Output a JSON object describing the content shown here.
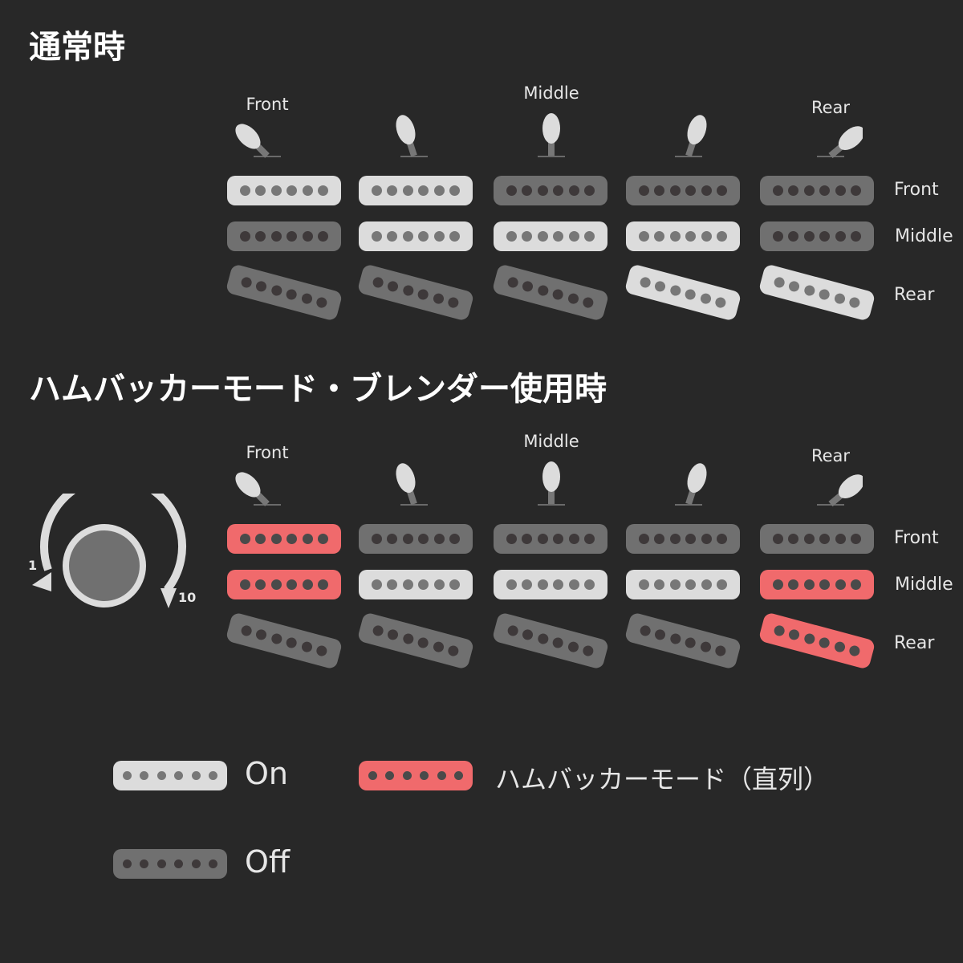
{
  "sections": [
    {
      "title": "通常時",
      "position_labels": [
        "Front",
        "Middle",
        "Rear"
      ],
      "row_labels": [
        "Front",
        "Middle",
        "Rear"
      ],
      "switch_positions": [
        {
          "position": 1,
          "label": "Front"
        },
        {
          "position": 2,
          "label": ""
        },
        {
          "position": 3,
          "label": "Middle"
        },
        {
          "position": 4,
          "label": ""
        },
        {
          "position": 5,
          "label": "Rear"
        }
      ],
      "pickup_states": [
        [
          "on",
          "on",
          "off",
          "off",
          "off"
        ],
        [
          "off",
          "on",
          "on",
          "on",
          "off"
        ],
        [
          "off",
          "off",
          "off",
          "on",
          "on"
        ]
      ]
    },
    {
      "title": "ハムバッカーモード・ブレンダー使用時",
      "position_labels": [
        "Front",
        "Middle",
        "Rear"
      ],
      "row_labels": [
        "Front",
        "Middle",
        "Rear"
      ],
      "switch_positions": [
        {
          "position": 1,
          "label": "Front"
        },
        {
          "position": 2,
          "label": ""
        },
        {
          "position": 3,
          "label": "Middle"
        },
        {
          "position": 4,
          "label": ""
        },
        {
          "position": 5,
          "label": "Rear"
        }
      ],
      "pickup_states": [
        [
          "hum",
          "off",
          "off",
          "off",
          "off"
        ],
        [
          "hum",
          "on",
          "on",
          "on",
          "hum"
        ],
        [
          "off",
          "off",
          "off",
          "off",
          "hum"
        ]
      ],
      "blender_knob": {
        "min_label": "1",
        "max_label": "10"
      }
    }
  ],
  "legend": [
    {
      "state": "on",
      "label": "On"
    },
    {
      "state": "hum",
      "label": "ハムバッカーモード（直列）"
    },
    {
      "state": "off",
      "label": "Off"
    }
  ],
  "colors": {
    "background": "#282828",
    "on": "#dcdcdc",
    "off": "#707070",
    "humbucker": "#f06a6c"
  }
}
